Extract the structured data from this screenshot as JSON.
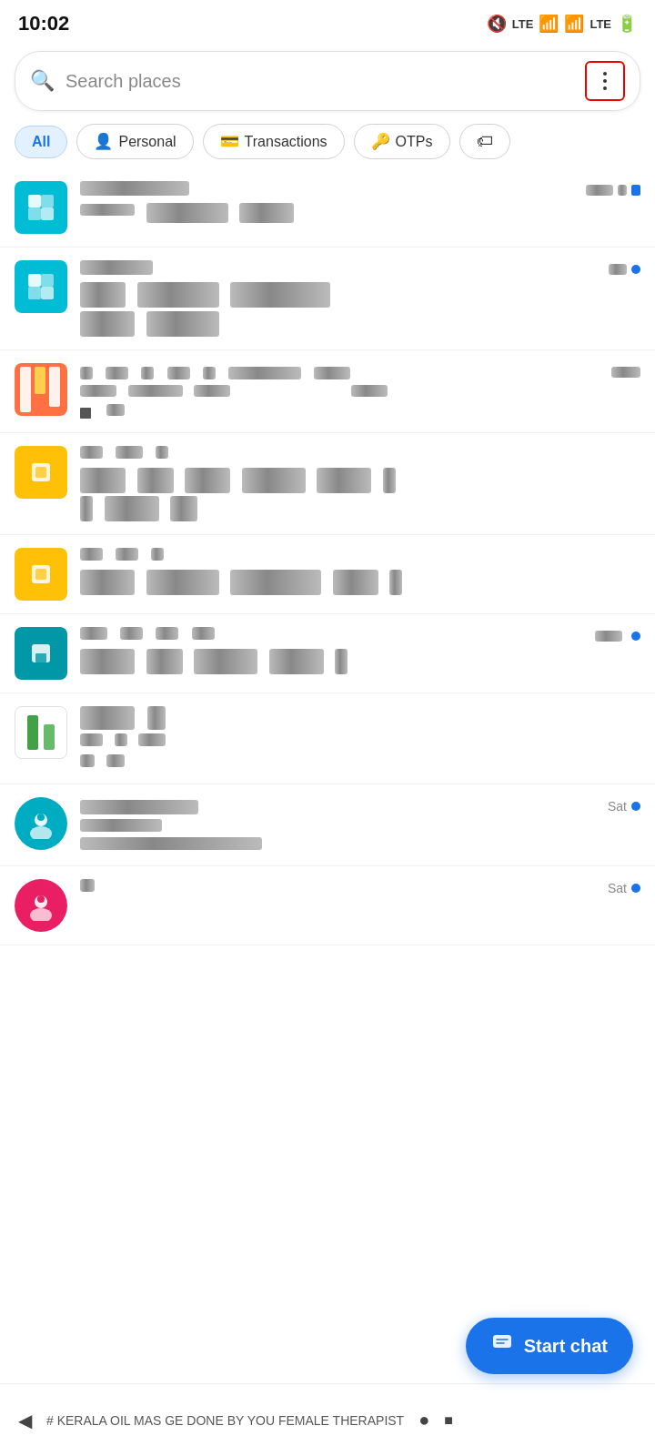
{
  "statusBar": {
    "time": "10:02",
    "icons": [
      "🔇",
      "LTE",
      "📶",
      "LTE",
      "🔋"
    ]
  },
  "searchBar": {
    "placeholder": "Search places",
    "moreBtn": "⋮"
  },
  "filterTabs": [
    {
      "id": "all",
      "label": "All",
      "active": true,
      "icon": ""
    },
    {
      "id": "personal",
      "label": "Personal",
      "active": false,
      "icon": "👤"
    },
    {
      "id": "transactions",
      "label": "Transactions",
      "active": false,
      "icon": "💳"
    },
    {
      "id": "otps",
      "label": "OTPs",
      "active": false,
      "icon": "🔑"
    }
  ],
  "messages": [
    {
      "id": 1,
      "avatarType": "sq-cyan",
      "senderName": "██████",
      "time": "",
      "hasUnread": false,
      "preview": "████ ██████ ████",
      "preview2": ""
    },
    {
      "id": 2,
      "avatarType": "sq-cyan",
      "senderName": "██ ██ █",
      "time": "",
      "hasUnread": true,
      "preview": "██ ████ ████████ ██",
      "preview2": "██ ████ ██"
    },
    {
      "id": 3,
      "avatarType": "sq-orange",
      "senderName": "█ ██ █ ██ █ ██████ ███",
      "time": "",
      "hasUnread": false,
      "preview": "███ ████ ████",
      "preview2": "█"
    },
    {
      "id": 4,
      "avatarType": "sq-yellow",
      "senderName": "███ ██ █",
      "time": "",
      "hasUnread": false,
      "preview": "████ ██ ████ ██████ █████ ██",
      "preview2": "█ ██████ ██"
    },
    {
      "id": 5,
      "avatarType": "sq-yellow",
      "senderName": "██ ██ █",
      "time": "",
      "hasUnread": false,
      "preview": "████████████████████",
      "preview2": ""
    },
    {
      "id": 6,
      "avatarType": "sq-cyan-dark",
      "senderName": "███ ██ ██ ██",
      "time": "",
      "hasUnread": true,
      "preview": "████ ███ █████ ████ █",
      "preview2": ""
    },
    {
      "id": 7,
      "avatarType": "sq-green",
      "senderName": "██ ██",
      "time": "",
      "hasUnread": false,
      "preview": "██ █ ██",
      "preview2": ""
    },
    {
      "id": 8,
      "avatarType": "circle-teal",
      "senderName": "CHARITA",
      "time": "Sat",
      "hasUnread": true,
      "preview": "████████",
      "preview2": "██████████████████"
    },
    {
      "id": 9,
      "avatarType": "circle-pink",
      "senderName": "█",
      "time": "Sat",
      "hasUnread": true,
      "preview": "",
      "preview2": ""
    }
  ],
  "fab": {
    "label": "Start chat",
    "icon": "💬"
  },
  "bottomBar": {
    "text": "# KERALA OIL MAS    GE DONE BY YOU FEMALE THERAPIST"
  }
}
